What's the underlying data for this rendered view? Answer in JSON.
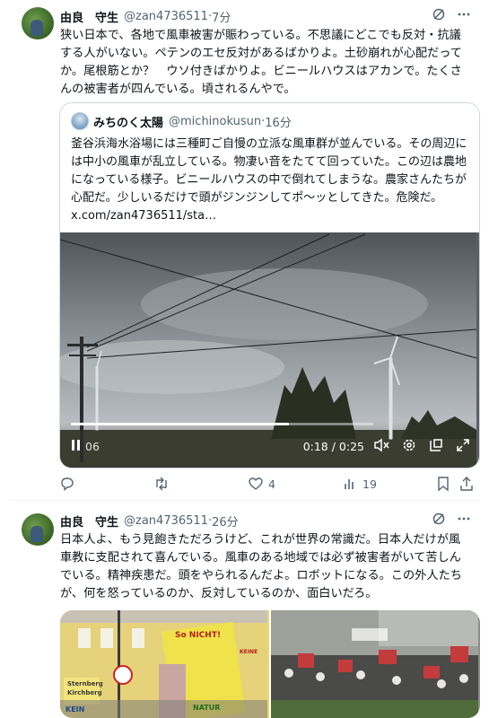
{
  "post1": {
    "author_name": "由良　守生",
    "handle": "@zan4736511",
    "time": "7分",
    "text": "狭い日本で、各地で風車被害が賑わっている。不思議にどこでも反対・抗議する人がいない。ペテンのエセ反対があるばかりよ。土砂崩れが心配だってか。尾根筋とか？　ウソ付きばかりよ。ビニールハウスはアカンで。たくさんの被害者が四んでいる。頃されるんやで。",
    "quote": {
      "author_name": "みちのく太陽",
      "handle": "@michinokusun",
      "time": "16分",
      "text": "釜谷浜海水浴場には三種町ご自慢の立派な風車群が並んでいる。その周辺には中小の風車が乱立している。物凄い音をたてて回っていた。この辺は農地になっている様子。ビニールハウスの中で倒れてしまうな。農家さんたちが心配だ。少しいるだけで頭がジンジンしてポ〜ッとしてきた。危険だ。　x.com/zan4736511/sta…",
      "video": {
        "current_time": "0:18",
        "duration": "0:25",
        "time_display": "0:18 / 0:25",
        "left_time_fragment": "06",
        "progress": 0.72
      }
    },
    "actions": {
      "reply_count": "",
      "retweet_count": "",
      "like_count": "4",
      "views_count": "19"
    }
  },
  "post2": {
    "author_name": "由良　守生",
    "handle": "@zan4736511",
    "time": "26分",
    "text": "日本人よ、もう見飽きただろうけど、これが世界の常識だ。日本人だけが風車教に支配されて喜んでいる。風車のある地域では必ず被害者がいて苦しんでいる。精神疾患だ。頭をやられるんだよ。ロボットになる。この外人たちが、何を怒っているのか、反対しているのか、面白いだろ。",
    "image1_signs": [
      "So NICHT!",
      "NATUR",
      "KEIN",
      "KEINE",
      "Sternberg",
      "Kirchberg"
    ],
    "image2_signs": []
  },
  "icons": {
    "grok": "grok-icon",
    "more": "more-icon",
    "reply": "reply-icon",
    "retweet": "retweet-icon",
    "like": "like-icon",
    "views": "views-icon",
    "bookmark": "bookmark-icon",
    "share": "share-icon"
  },
  "colors": {
    "text": "#0f1419",
    "muted": "#536471",
    "border": "#cfd9de"
  }
}
